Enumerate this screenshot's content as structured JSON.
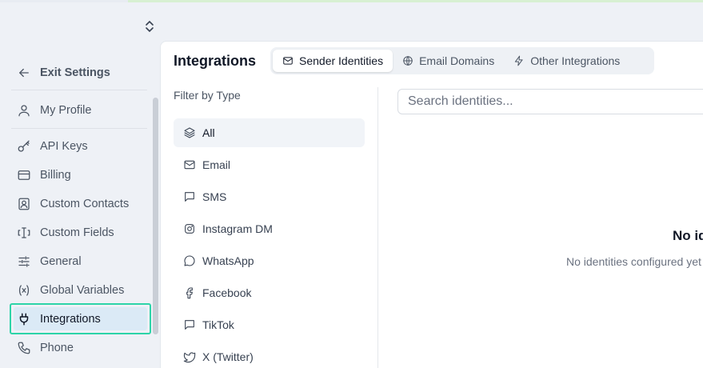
{
  "sidebar": {
    "exit": "Exit Settings",
    "items": [
      {
        "label": "My Profile",
        "icon": "user-icon"
      },
      {
        "label": "API Keys",
        "icon": "key-icon"
      },
      {
        "label": "Billing",
        "icon": "credit-card-icon"
      },
      {
        "label": "Custom Contacts",
        "icon": "contact-card-icon"
      },
      {
        "label": "Custom Fields",
        "icon": "text-field-icon"
      },
      {
        "label": "General",
        "icon": "sliders-icon"
      },
      {
        "label": "Global Variables",
        "icon": "variable-icon"
      },
      {
        "label": "Integrations",
        "icon": "plug-icon",
        "active": true
      },
      {
        "label": "Phone",
        "icon": "phone-icon"
      }
    ]
  },
  "main": {
    "title": "Integrations",
    "tabs": [
      {
        "label": "Sender Identities",
        "icon": "mail-icon",
        "active": true
      },
      {
        "label": "Email Domains",
        "icon": "globe-icon"
      },
      {
        "label": "Other Integrations",
        "icon": "zap-icon"
      }
    ],
    "filter_title": "Filter by Type",
    "filters": [
      {
        "label": "All",
        "icon": "layers-icon",
        "active": true
      },
      {
        "label": "Email",
        "icon": "mail-icon"
      },
      {
        "label": "SMS",
        "icon": "message-square-icon"
      },
      {
        "label": "Instagram DM",
        "icon": "instagram-icon"
      },
      {
        "label": "WhatsApp",
        "icon": "message-circle-icon"
      },
      {
        "label": "Facebook",
        "icon": "facebook-icon"
      },
      {
        "label": "TikTok",
        "icon": "message-square-icon"
      },
      {
        "label": "X (Twitter)",
        "icon": "twitter-icon"
      }
    ],
    "search_placeholder": "Search identities...",
    "empty_title": "No identities configured",
    "empty_subtitle": "No identities configured yet"
  },
  "colors": {
    "active_outline": "#2dd4a8",
    "active_bg": "#dbeaf6",
    "page_bg": "#eef1f6"
  }
}
